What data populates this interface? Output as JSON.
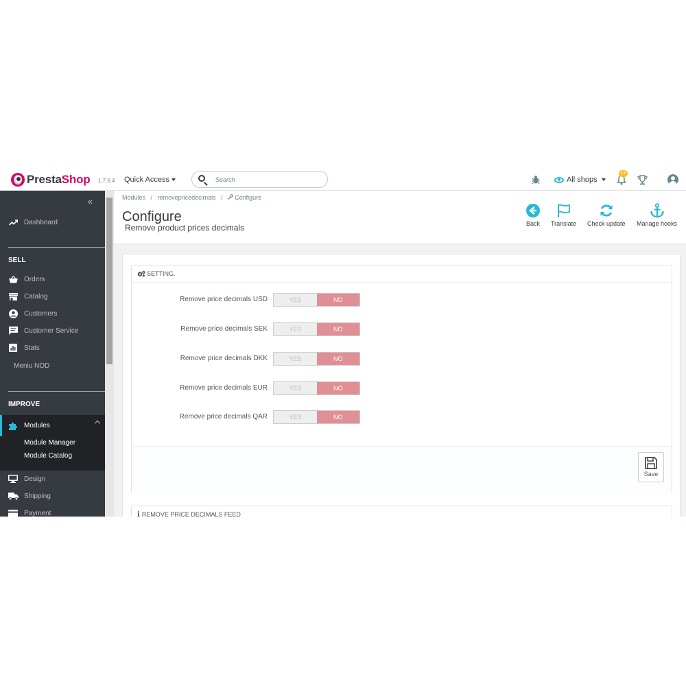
{
  "header": {
    "logo_part1": "Presta",
    "logo_part2": "Shop",
    "version": "1.7.6.4",
    "quick_access": "Quick Access",
    "search_placeholder": "Search",
    "shops_label": "All shops",
    "notifications_count": "13"
  },
  "sidebar": {
    "collapse_glyph": "«",
    "dashboard": "Dashboard",
    "section_sell": "SELL",
    "sell_items": [
      "Orders",
      "Catalog",
      "Customers",
      "Customer Service",
      "Stats"
    ],
    "meniu_nod": "Meniu NOD",
    "section_improve": "IMPROVE",
    "modules": "Modules",
    "module_submenu": [
      "Module Manager",
      "Module Catalog"
    ],
    "improve_items": [
      "Design",
      "Shipping",
      "Payment"
    ]
  },
  "breadcrumb": {
    "items": [
      "Modules",
      "removepricedecimals",
      "Configure"
    ],
    "separator": "/"
  },
  "page": {
    "title": "Configure",
    "subtitle": "Remove product prices decimals"
  },
  "toolbar": {
    "back": "Back",
    "translate": "Translate",
    "check_update": "Check update",
    "manage_hooks": "Manage hooks"
  },
  "setting_panel": {
    "heading": "SETTING.",
    "yes_label": "YES",
    "no_label": "NO",
    "rows": [
      {
        "label": "Remove price decimals USD",
        "value": "NO"
      },
      {
        "label": "Remove price decimals SEK",
        "value": "NO"
      },
      {
        "label": "Remove price decimals DKK",
        "value": "NO"
      },
      {
        "label": "Remove price decimals EUR",
        "value": "NO"
      },
      {
        "label": "Remove price decimals QAR",
        "value": "NO"
      }
    ],
    "save_label": "Save"
  },
  "feed_panel": {
    "heading": "REMOVE PRICE DECIMALS FEED"
  },
  "colors": {
    "brand": "#df0067",
    "accent": "#25b9d7",
    "sidebar_bg": "#363a41",
    "switch_no": "#e08f95"
  }
}
